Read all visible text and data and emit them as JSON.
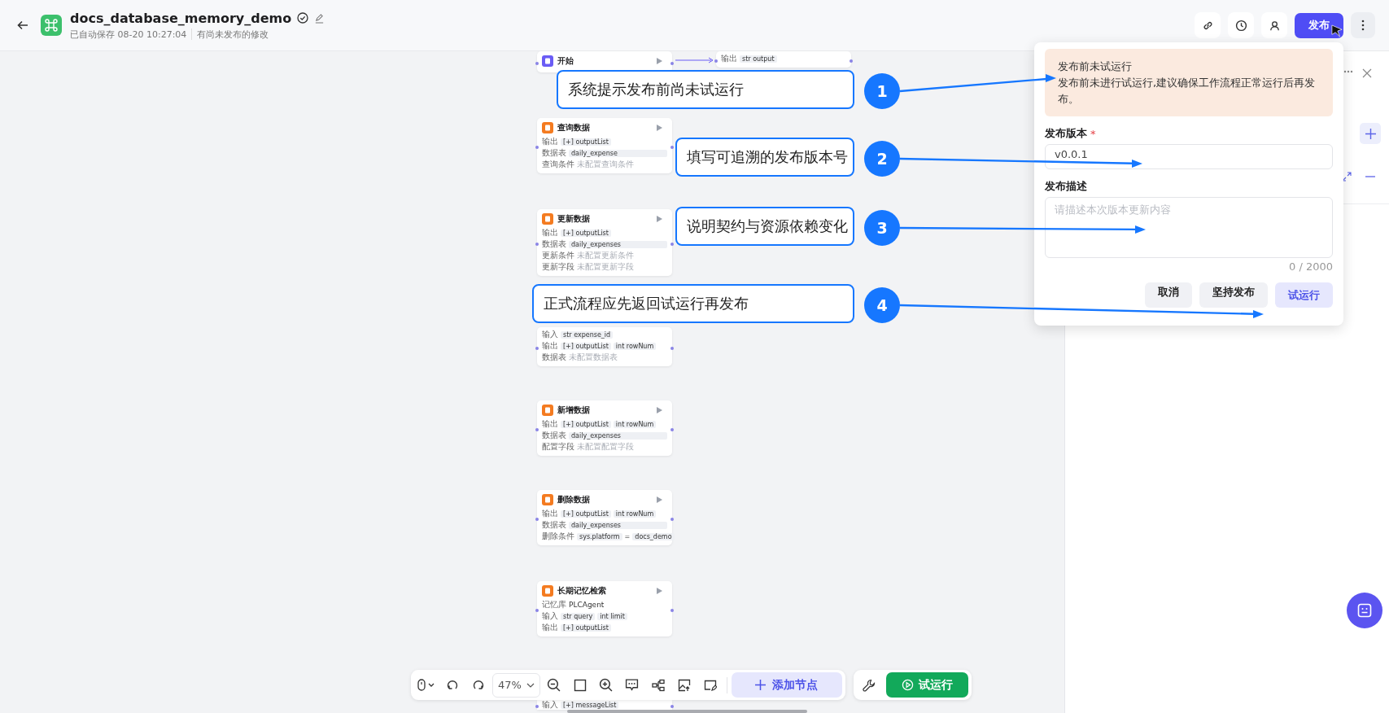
{
  "header": {
    "title": "docs_database_memory_demo",
    "autosave": "已自动保存 08-20 10:27:04",
    "status": "有尚未发布的修改",
    "publish_button": "发布"
  },
  "canvas": {
    "nodes": [
      {
        "title": "开始"
      },
      {
        "rows": [
          {
            "kind": "vars",
            "label": "输出",
            "chips": [
              {
                "type": "str",
                "text": "output"
              }
            ]
          }
        ]
      },
      {
        "title": "查询数据",
        "rows": [
          {
            "kind": "vars",
            "label": "输出",
            "chips": [
              {
                "type": "[+]",
                "text": "outputList"
              }
            ]
          },
          {
            "kind": "value",
            "label": "数据表",
            "text": "daily_expense"
          },
          {
            "kind": "placeholder",
            "label": "查询条件",
            "text": "未配置查询条件"
          }
        ]
      },
      {
        "title": "更新数据",
        "rows": [
          {
            "kind": "vars",
            "label": "输出",
            "chips": [
              {
                "type": "[+]",
                "text": "outputList"
              }
            ]
          },
          {
            "kind": "value",
            "label": "数据表",
            "text": "daily_expenses"
          },
          {
            "kind": "placeholder",
            "label": "更新条件",
            "text": "未配置更新条件"
          },
          {
            "kind": "placeholder",
            "label": "更新字段",
            "text": "未配置更新字段"
          }
        ]
      },
      {
        "rows": [
          {
            "kind": "vars",
            "label": "输入",
            "chips": [
              {
                "type": "str",
                "text": "expense_id"
              }
            ]
          },
          {
            "kind": "vars",
            "label": "输出",
            "chips": [
              {
                "type": "[+]",
                "text": "outputList"
              },
              {
                "type": "int",
                "text": "rowNum"
              }
            ]
          },
          {
            "kind": "placeholder",
            "label": "数据表",
            "text": "未配置数据表"
          }
        ]
      },
      {
        "title": "新增数据",
        "rows": [
          {
            "kind": "vars",
            "label": "输出",
            "chips": [
              {
                "type": "[+]",
                "text": "outputList"
              },
              {
                "type": "int",
                "text": "rowNum"
              }
            ]
          },
          {
            "kind": "value",
            "label": "数据表",
            "text": "daily_expenses"
          },
          {
            "kind": "placeholder",
            "label": "配置字段",
            "text": "未配置配置字段"
          }
        ]
      },
      {
        "title": "删除数据",
        "rows": [
          {
            "kind": "vars",
            "label": "输出",
            "chips": [
              {
                "type": "[+]",
                "text": "outputList"
              },
              {
                "type": "int",
                "text": "rowNum"
              }
            ]
          },
          {
            "kind": "value",
            "label": "数据表",
            "text": "daily_expenses"
          },
          {
            "kind": "condition",
            "label": "删除条件",
            "left": "sys.platform",
            "op": "=",
            "right": "docs_demo"
          }
        ]
      },
      {
        "title": "长期记忆检索",
        "rows": [
          {
            "kind": "plain",
            "label": "记忆库",
            "text": "PLCAgent"
          },
          {
            "kind": "vars",
            "label": "输入",
            "chips": [
              {
                "type": "str",
                "text": "query"
              },
              {
                "type": "int",
                "text": "limit"
              }
            ]
          },
          {
            "kind": "vars",
            "label": "输出",
            "chips": [
              {
                "type": "[+]",
                "text": "outputList"
              }
            ]
          }
        ]
      },
      {
        "rows": [
          {
            "kind": "vars",
            "label": "输入",
            "chips": [
              {
                "type": "[+]",
                "text": "messageList"
              }
            ]
          }
        ]
      }
    ]
  },
  "annotations": [
    {
      "number": "1",
      "text": "系统提示发布前尚未试运行"
    },
    {
      "number": "2",
      "text": "填写可追溯的发布版本号"
    },
    {
      "number": "3",
      "text": "说明契约与资源依赖变化"
    },
    {
      "number": "4",
      "text": "正式流程应先返回试运行再发布"
    }
  ],
  "publish_popover": {
    "warning_title": "发布前未试运行",
    "warning_text": "发布前未进行试运行,建议确保工作流程正常运行后再发布。",
    "version_label": "发布版本",
    "required_mark": "*",
    "version_value": "v0.0.1",
    "description_label": "发布描述",
    "description_placeholder": "请描述本次版本更新内容",
    "count": "0 / 2000",
    "buttons": [
      {
        "kind": "secondary",
        "label": "取消"
      },
      {
        "kind": "secondary",
        "label": "坚持发布"
      },
      {
        "kind": "primary",
        "label": "试运行"
      }
    ]
  },
  "bottom_toolbar": {
    "zoom": "47%",
    "add_node": "添加节点",
    "test_run": "试运行"
  }
}
